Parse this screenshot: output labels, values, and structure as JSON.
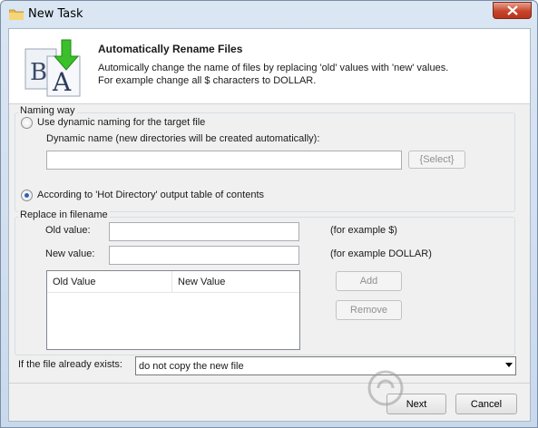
{
  "window": {
    "title": "New Task",
    "close_label": "✕"
  },
  "header": {
    "title": "Automatically Rename Files",
    "desc1": "Automically change the name of files by replacing  'old'  values with  'new' values.",
    "desc2": "For example change all $ characters to DOLLAR."
  },
  "naming": {
    "group_label": "Naming way",
    "dynamic_label": "Use dynamic naming for the target file",
    "dynamic_name_label": "Dynamic name (new directories will be created automatically):",
    "dynamic_name_value": "",
    "select_button": "{Select}",
    "hotdir_label": "According to 'Hot Directory' output table of contents",
    "selected": "hotdir"
  },
  "replace": {
    "group_label": "Replace in filename",
    "old_label": "Old value:",
    "old_value": "",
    "old_example": "(for example $)",
    "new_label": "New value:",
    "new_value": "",
    "new_example": "(for example DOLLAR)",
    "columns": [
      "Old Value",
      "New Value"
    ],
    "rows": [],
    "add_button": "Add",
    "remove_button": "Remove"
  },
  "exists": {
    "label": "If the file already exists:",
    "selected": "do not copy the new file"
  },
  "footer": {
    "next_button": "Next",
    "cancel_button": "Cancel"
  }
}
